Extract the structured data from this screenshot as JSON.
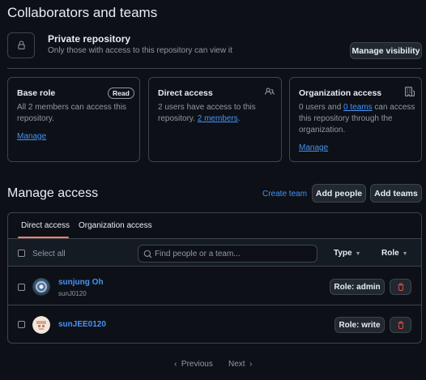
{
  "page": {
    "title": "Collaborators and teams"
  },
  "visibility": {
    "title": "Private repository",
    "subtitle": "Only those with access to this repository can view it",
    "button": "Manage visibility"
  },
  "cards": {
    "base_role": {
      "title": "Base role",
      "badge": "Read",
      "text": "All 2 members can access this repository.",
      "link": "Manage"
    },
    "direct_access": {
      "title": "Direct access",
      "text_pre": "2 users have access to this repository.",
      "link": "2 members",
      "text_post": "."
    },
    "org_access": {
      "title": "Organization access",
      "text_pre": "0 users and",
      "link_teams": "0 teams",
      "text_post": "can access this repository through the organization.",
      "link": "Manage"
    }
  },
  "manage": {
    "title": "Manage access",
    "create_team": "Create team",
    "add_people": "Add people",
    "add_teams": "Add teams"
  },
  "table": {
    "tabs": [
      "Direct access",
      "Organization access"
    ],
    "select_all": "Select all",
    "search_placeholder": "Find people or a team...",
    "filter_type": "Type",
    "filter_role": "Role",
    "rows": [
      {
        "name": "sunjung Oh",
        "handle": "sunJ0120",
        "role": "Role: admin"
      },
      {
        "name": "sunJEE0120",
        "handle": "",
        "role": "Role: write"
      }
    ]
  },
  "pagination": {
    "previous": "Previous",
    "next": "Next"
  },
  "colors": {
    "accent": "#4493f8",
    "danger": "#f85149",
    "tab_underline": "#f78166",
    "background": "#0d1117"
  }
}
